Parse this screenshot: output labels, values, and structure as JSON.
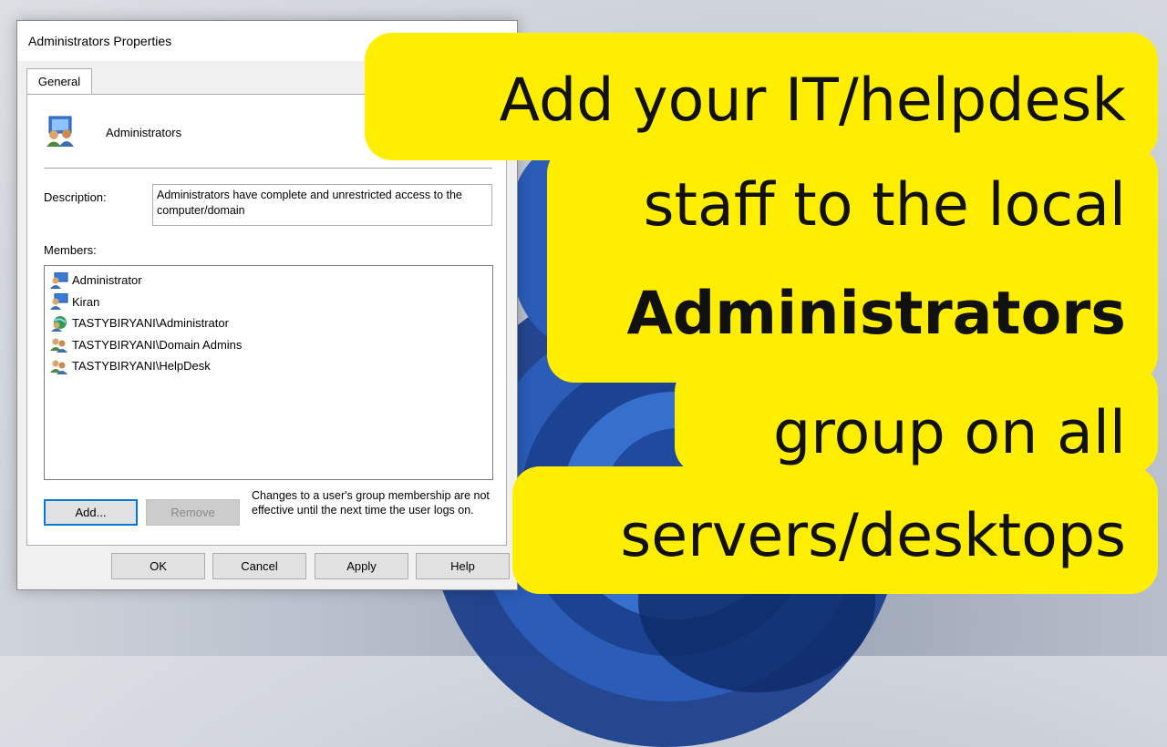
{
  "dialog": {
    "title": "Administrators Properties",
    "tab_general": "General",
    "group_name": "Administrators",
    "description_label": "Description:",
    "description_value": "Administrators have complete and unrestricted access to the computer/domain",
    "members_label": "Members:",
    "members": [
      {
        "name": "Administrator",
        "icon": "local-user-icon"
      },
      {
        "name": "Kiran",
        "icon": "local-user-icon"
      },
      {
        "name": "TASTYBIRYANI\\Administrator",
        "icon": "domain-user-icon"
      },
      {
        "name": "TASTYBIRYANI\\Domain Admins",
        "icon": "group-icon"
      },
      {
        "name": "TASTYBIRYANI\\HelpDesk",
        "icon": "group-icon"
      }
    ],
    "add_label": "Add...",
    "remove_label": "Remove",
    "note": "Changes to a user's group membership are not effective until the next time the user logs on.",
    "ok_label": "OK",
    "cancel_label": "Cancel",
    "apply_label": "Apply",
    "help_label": "Help"
  },
  "caption": {
    "line1": "Add your IT/helpdesk",
    "line2": "staff to the local",
    "line3": "Administrators",
    "line4": "group on all",
    "line5": "servers/desktops"
  },
  "colors": {
    "callout": "#ffee00",
    "wallpaper_bloom": "#2a5cb8",
    "focus_border": "#0078d7"
  }
}
